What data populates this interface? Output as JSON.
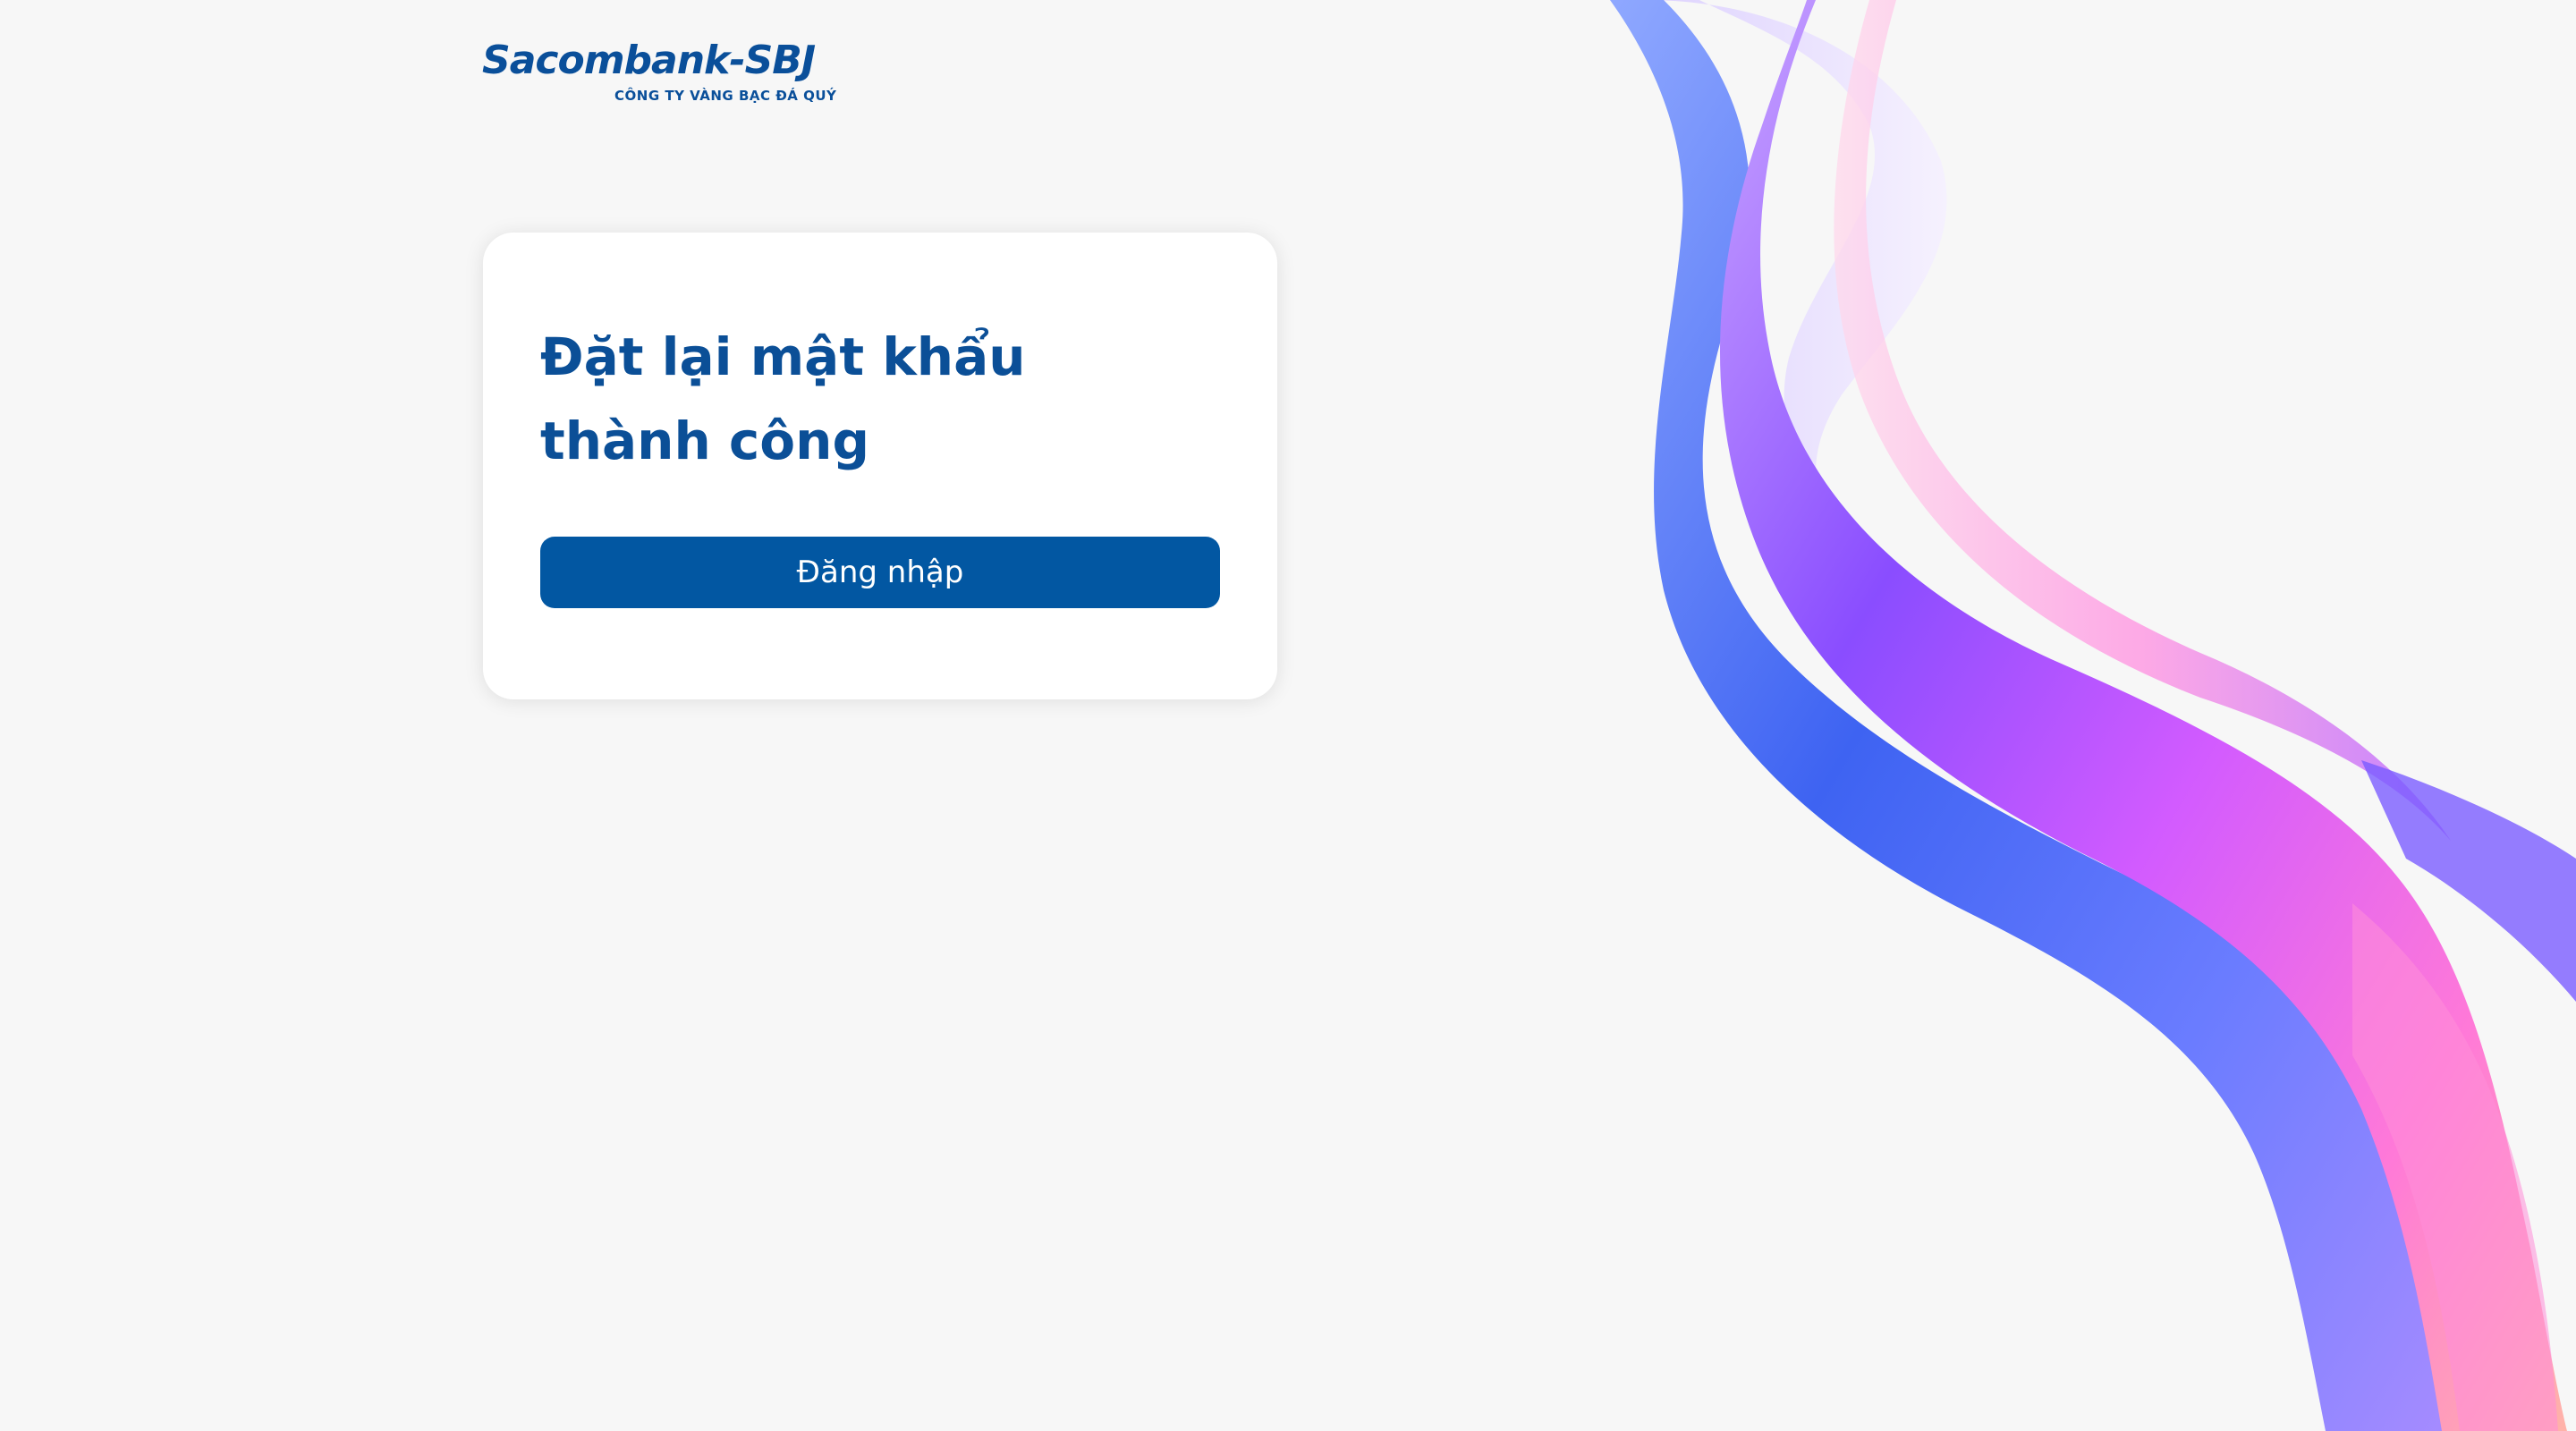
{
  "brand": {
    "name": "Sacombank-SBJ",
    "tagline": "CÔNG TY VÀNG BẠC ĐÁ QUÝ",
    "color": "#0a4f9a"
  },
  "card": {
    "title": "Đặt lại mật khẩu thành công",
    "login_button_label": "Đăng nhập"
  },
  "colors": {
    "page_background": "#f7f7f7",
    "primary": "#0257a2",
    "title": "#0b4f97"
  }
}
